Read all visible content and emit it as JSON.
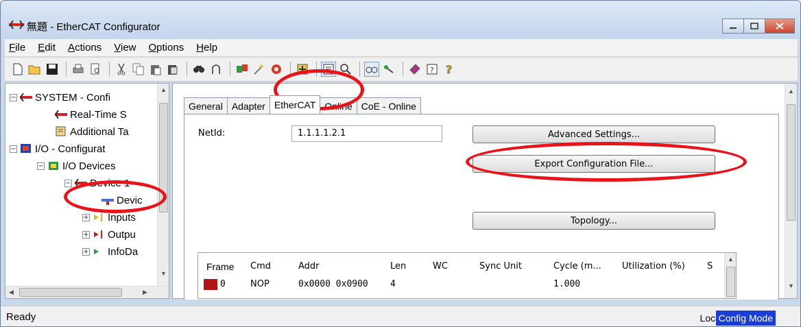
{
  "window": {
    "title": "無題 - EtherCAT Configurator",
    "controls": [
      "minimize",
      "maximize",
      "close"
    ]
  },
  "menu": [
    {
      "label": "File",
      "accel": "F",
      "rest": "ile"
    },
    {
      "label": "Edit",
      "accel": "E",
      "rest": "dit"
    },
    {
      "label": "Actions",
      "accel": "A",
      "rest": "ctions"
    },
    {
      "label": "View",
      "accel": "V",
      "rest": "iew"
    },
    {
      "label": "Options",
      "accel": "O",
      "rest": "ptions"
    },
    {
      "label": "Help",
      "accel": "H",
      "rest": "elp"
    }
  ],
  "toolbar_icons": [
    "new-icon",
    "open-icon",
    "save-icon",
    "print-icon",
    "print-preview-icon",
    "cut-icon",
    "copy-icon",
    "paste-icon",
    "paste-special-icon",
    "find-icon",
    "find-next-icon",
    "scan-icon",
    "wand-icon",
    "reload-icon",
    "insert-icon",
    "tree-view-icon",
    "zoom-icon",
    "glasses-icon",
    "link-icon",
    "book-icon",
    "help-icon",
    "whats-this-icon"
  ],
  "tree": {
    "items": [
      {
        "label": "SYSTEM - Confi",
        "expander": "⊟",
        "icon": "system-icon"
      },
      {
        "label": "Real-Time S",
        "expander": "",
        "icon": "realtime-icon"
      },
      {
        "label": "Additional Ta",
        "expander": "",
        "icon": "tasks-icon"
      },
      {
        "label": "I/O - Configurat",
        "expander": "⊟",
        "icon": "io-config-icon"
      },
      {
        "label": "I/O Devices",
        "expander": "⊟",
        "icon": "io-devices-icon"
      },
      {
        "label": "Device 1",
        "expander": "⊟",
        "icon": "device-icon"
      },
      {
        "label": "Devic",
        "expander": "",
        "icon": "device-image-icon"
      },
      {
        "label": "Inputs",
        "expander": "⊞",
        "icon": "inputs-icon"
      },
      {
        "label": "Outpu",
        "expander": "⊞",
        "icon": "outputs-icon"
      },
      {
        "label": "InfoDa",
        "expander": "⊞",
        "icon": "infodata-icon"
      }
    ]
  },
  "tabs": [
    "General",
    "Adapter",
    "EtherCAT",
    "Online",
    "CoE - Online"
  ],
  "active_tab": "EtherCAT",
  "ethercat": {
    "netid_label": "NetId:",
    "netid_value": "1.1.1.1.2.1",
    "advanced_button": "Advanced Settings...",
    "export_button": "Export Configuration File...",
    "topology_button": "Topology..."
  },
  "frame_table": {
    "columns": [
      "Frame",
      "Cmd",
      "Addr",
      "Len",
      "WC",
      "Sync Unit",
      "Cycle (m...",
      "Utilization (%)",
      "S"
    ],
    "rows": [
      {
        "frame": "0",
        "cmd": "NOP",
        "addr": "0x0000 0x0900",
        "len": "4",
        "wc": "",
        "sync": "",
        "cycle": "1.000",
        "util": "",
        "s": ""
      }
    ]
  },
  "status": {
    "left": "Ready",
    "local": "Local",
    "mode": "Config Mode"
  },
  "colors": {
    "annotation": "#e8141a",
    "config_mode_bg": "#1a3dd6",
    "frame_swatch": "#b01414"
  }
}
